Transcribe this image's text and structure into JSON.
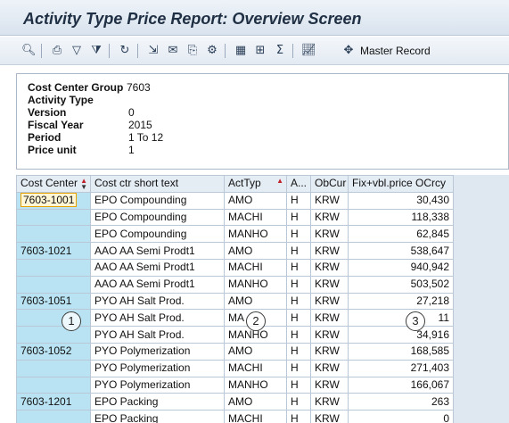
{
  "window": {
    "title": "Activity Type Price Report: Overview Screen"
  },
  "toolbar": {
    "icons": [
      "search-icon",
      "print-icon",
      "filter-icon",
      "filter-delete-icon",
      "refresh-icon",
      "export-icon",
      "mail-icon",
      "copy-icon",
      "settings-icon",
      "grid-layout-icon",
      "insert-icon",
      "sum-icon",
      "graphic-icon"
    ],
    "master_record_label": "Master Record"
  },
  "header": {
    "fields": [
      {
        "label": "Cost Center Group",
        "value": "7603"
      },
      {
        "label": "Activity Type",
        "value": ""
      },
      {
        "label": "Version",
        "value": "0"
      },
      {
        "label": "Fiscal Year",
        "value": "2015"
      },
      {
        "label": "Period",
        "value": "1 To 12"
      },
      {
        "label": "Price unit",
        "value": "1"
      }
    ]
  },
  "grid": {
    "columns": [
      "Cost Center",
      "Cost ctr short text",
      "ActTyp",
      "A...",
      "ObCur",
      "Fix+vbl.price OCrcy"
    ],
    "rows": [
      {
        "cost_center": "7603-1001",
        "text": "EPO Compounding",
        "acttyp": "AMO",
        "a": "H",
        "obcur": "KRW",
        "price": "30,430"
      },
      {
        "cost_center": "",
        "text": "EPO Compounding",
        "acttyp": "MACHI",
        "a": "H",
        "obcur": "KRW",
        "price": "118,338"
      },
      {
        "cost_center": "",
        "text": "EPO Compounding",
        "acttyp": "MANHO",
        "a": "H",
        "obcur": "KRW",
        "price": "62,845"
      },
      {
        "cost_center": "7603-1021",
        "text": "AAO AA Semi Prodt1",
        "acttyp": "AMO",
        "a": "H",
        "obcur": "KRW",
        "price": "538,647"
      },
      {
        "cost_center": "",
        "text": "AAO AA Semi Prodt1",
        "acttyp": "MACHI",
        "a": "H",
        "obcur": "KRW",
        "price": "940,942"
      },
      {
        "cost_center": "",
        "text": "AAO AA Semi Prodt1",
        "acttyp": "MANHO",
        "a": "H",
        "obcur": "KRW",
        "price": "503,502"
      },
      {
        "cost_center": "7603-1051",
        "text": "PYO AH Salt Prod.",
        "acttyp": "AMO",
        "a": "H",
        "obcur": "KRW",
        "price": "27,218"
      },
      {
        "cost_center": "",
        "text": "PYO AH Salt Prod.",
        "acttyp": "MA",
        "a": "H",
        "obcur": "KRW",
        "price": "11"
      },
      {
        "cost_center": "",
        "text": "PYO AH Salt Prod.",
        "acttyp": "MANHO",
        "a": "H",
        "obcur": "KRW",
        "price": "34,916"
      },
      {
        "cost_center": "7603-1052",
        "text": "PYO Polymerization",
        "acttyp": "AMO",
        "a": "H",
        "obcur": "KRW",
        "price": "168,585"
      },
      {
        "cost_center": "",
        "text": "PYO Polymerization",
        "acttyp": "MACHI",
        "a": "H",
        "obcur": "KRW",
        "price": "271,403"
      },
      {
        "cost_center": "",
        "text": "PYO Polymerization",
        "acttyp": "MANHO",
        "a": "H",
        "obcur": "KRW",
        "price": "166,067"
      },
      {
        "cost_center": "7603-1201",
        "text": "EPO Packing",
        "acttyp": "AMO",
        "a": "H",
        "obcur": "KRW",
        "price": "263"
      },
      {
        "cost_center": "",
        "text": "EPO Packing",
        "acttyp": "MACHI",
        "a": "H",
        "obcur": "KRW",
        "price": "0"
      }
    ]
  },
  "annotations": [
    "1",
    "2",
    "3"
  ]
}
